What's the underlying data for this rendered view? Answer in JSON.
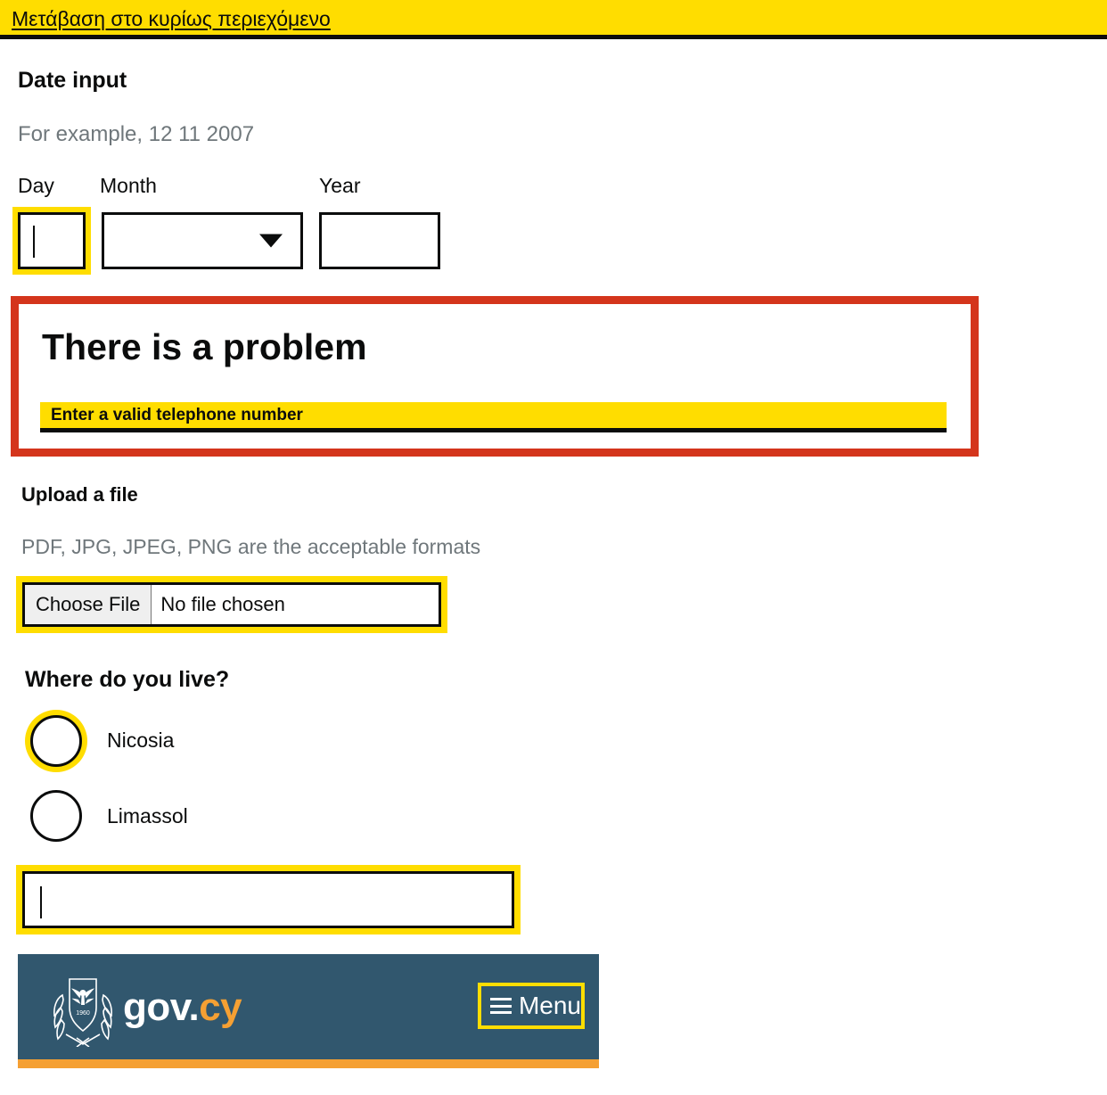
{
  "skip": {
    "label": "Μετάβαση στο κυρίως περιεχόμενο"
  },
  "date_section": {
    "heading": "Date input",
    "hint": "For example, 12 11 2007",
    "day_label": "Day",
    "month_label": "Month",
    "year_label": "Year",
    "day_value": "",
    "month_value": "",
    "year_value": ""
  },
  "error_summary": {
    "title": "There is a problem",
    "link": "Enter a valid telephone number"
  },
  "upload_section": {
    "heading": "Upload a file",
    "hint": "PDF, JPG, JPEG, PNG are the acceptable formats",
    "button_label": "Choose File",
    "status": "No file chosen"
  },
  "radio_section": {
    "heading": "Where do you live?",
    "options": [
      {
        "label": "Nicosia"
      },
      {
        "label": "Limassol"
      }
    ]
  },
  "text_input": {
    "value": ""
  },
  "gov_header": {
    "wordmark_main": "gov.",
    "wordmark_tld": "cy",
    "menu_label": "Menu",
    "crest_icon": "cyprus-coat-of-arms-icon",
    "menu_icon": "hamburger-icon"
  },
  "colors": {
    "yellow": "#ffdd00",
    "black": "#0b0c0c",
    "red": "#d4351c",
    "hint_grey": "#6f777b",
    "gov_blue": "#31576e",
    "gov_orange": "#f5a033"
  }
}
